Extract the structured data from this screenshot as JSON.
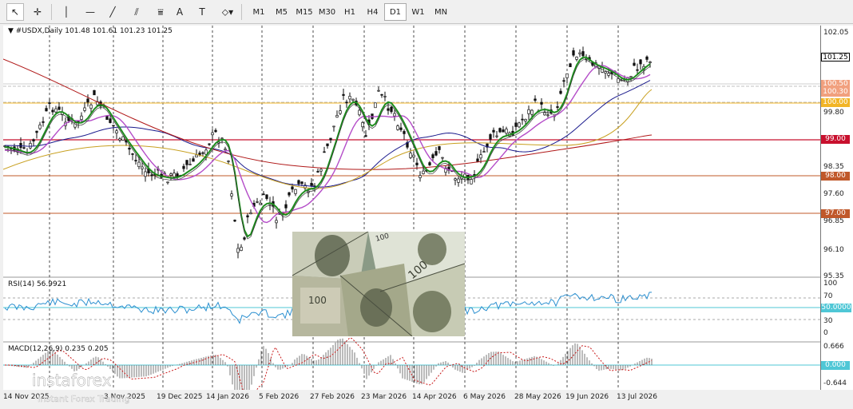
{
  "toolbar": {
    "tools": [
      {
        "name": "cursor-icon",
        "glyph": "↖"
      },
      {
        "name": "crosshair-icon",
        "glyph": "✛"
      },
      {
        "name": "vertical-line-icon",
        "glyph": "│"
      },
      {
        "name": "horizontal-line-icon",
        "glyph": "—"
      },
      {
        "name": "trendline-icon",
        "glyph": "╱"
      },
      {
        "name": "equidistant-channel-icon",
        "glyph": "⫽"
      },
      {
        "name": "fibonacci-icon",
        "glyph": "⩸"
      },
      {
        "name": "text-icon",
        "glyph": "A"
      },
      {
        "name": "text-label-icon",
        "glyph": "T"
      },
      {
        "name": "shapes-icon",
        "glyph": "⬦▾"
      }
    ],
    "timeframes": [
      "M1",
      "M5",
      "M15",
      "M30",
      "H1",
      "H4",
      "D1",
      "W1",
      "MN"
    ],
    "active_timeframe": "D1"
  },
  "chart_header": {
    "symbol": "#USDX,Daily",
    "ohlc": "101.48 101.61 101.23 101.25"
  },
  "price_axis": {
    "labels": [
      "102.05",
      "99.80",
      "98.35",
      "97.60",
      "96.85",
      "96.10",
      "95.35"
    ],
    "current_price": "101.25",
    "levels": [
      {
        "label": "100.50",
        "color": "#f1a07e"
      },
      {
        "label": "100.30",
        "color": "#f1a07e"
      },
      {
        "label": "100.00",
        "color": "#f2b526"
      },
      {
        "label": "99.00",
        "color": "#c8102e"
      },
      {
        "label": "98.00",
        "color": "#c0582a"
      },
      {
        "label": "97.00",
        "color": "#c0582a"
      }
    ]
  },
  "rsi": {
    "label": "RSI(14) 56.9921",
    "axis": [
      "100",
      "70",
      "50",
      "30",
      "0"
    ],
    "level_tag": "50.0000"
  },
  "macd": {
    "label": "MACD(12,26,9) 0.235 0.205",
    "axis": [
      "0.666",
      "0.000",
      "-0.644"
    ],
    "zero_tag": "0.000"
  },
  "dates": [
    "14 Nov 2025",
    "3 Nov 2025",
    "19 Dec 2025",
    "14 Jan 2026",
    "5 Feb 2026",
    "27 Feb 2026",
    "23 Mar 2026",
    "14 Apr 2026",
    "6 May 2026",
    "28 May 2026",
    "19 Jun 2026",
    "13 Jul 2026"
  ],
  "logo": {
    "brand": "instaforex",
    "tagline": "Instant Forex Trading"
  },
  "colors": {
    "bull": "#111111",
    "ma_fast": "#1e8c1e",
    "ma_mid": "#b44cc8",
    "ma_slow": "#1a1a8c",
    "ma_200": "#b01818",
    "ma_100": "#c8a020",
    "rsi_line": "#2a8fd0",
    "macd_signal": "#c81818"
  }
}
